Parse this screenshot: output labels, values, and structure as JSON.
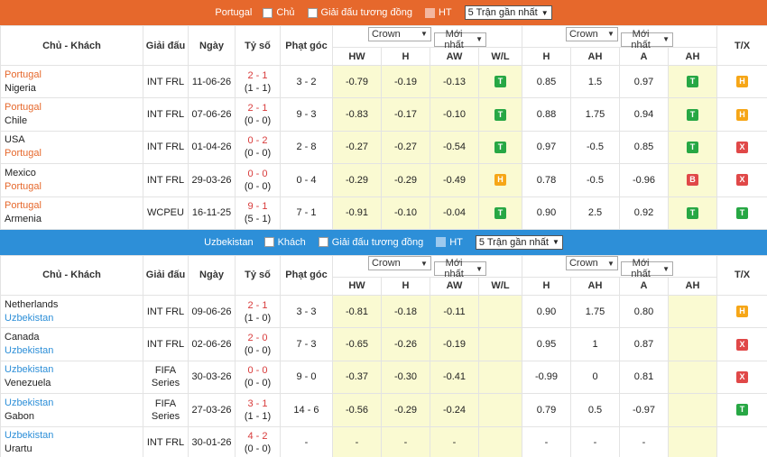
{
  "section1": {
    "team": "Portugal",
    "filter_home": "Chủ",
    "filter_same_league": "Giải đấu tương đồng",
    "filter_ht": "HT",
    "select_recent": "5 Trận gần nhất",
    "headers": {
      "teams": "Chủ - Khách",
      "league": "Giải đấu",
      "date": "Ngày",
      "score": "Tỷ số",
      "corners": "Phạt góc",
      "tx": "T/X",
      "odds1_book": "Crown",
      "odds1_time": "Mới nhất",
      "odds2_book": "Crown",
      "odds2_time": "Mới nhất",
      "hw": "HW",
      "h": "H",
      "aw": "AW",
      "wl": "W/L",
      "h2": "H",
      "ah": "AH",
      "a": "A",
      "ah2": "AH"
    },
    "rows": [
      {
        "home": "Portugal",
        "away": "Nigeria",
        "home_hl": true,
        "league": "INT FRL",
        "date": "11-06-26",
        "ft": "2 - 1",
        "ht": "(1 - 1)",
        "corners": "3 - 2",
        "hw": "-0.79",
        "h": "-0.19",
        "aw": "-0.13",
        "wl": "T",
        "h2": "0.85",
        "ah": "1.5",
        "a": "0.97",
        "ah_res": "T",
        "tx": "H"
      },
      {
        "home": "Portugal",
        "away": "Chile",
        "home_hl": true,
        "league": "INT FRL",
        "date": "07-06-26",
        "ft": "2 - 1",
        "ht": "(0 - 0)",
        "corners": "9 - 3",
        "hw": "-0.83",
        "h": "-0.17",
        "aw": "-0.10",
        "wl": "T",
        "h2": "0.88",
        "ah": "1.75",
        "a": "0.94",
        "ah_res": "T",
        "tx": "H"
      },
      {
        "home": "USA",
        "away": "Portugal",
        "home_hl": false,
        "league": "INT FRL",
        "date": "01-04-26",
        "ft": "0 - 2",
        "ht": "(0 - 0)",
        "corners": "2 - 8",
        "hw": "-0.27",
        "h": "-0.27",
        "aw": "-0.54",
        "wl": "T",
        "h2": "0.97",
        "ah": "-0.5",
        "a": "0.85",
        "ah_res": "T",
        "tx": "X"
      },
      {
        "home": "Mexico",
        "away": "Portugal",
        "home_hl": false,
        "league": "INT FRL",
        "date": "29-03-26",
        "ft": "0 - 0",
        "ht": "(0 - 0)",
        "corners": "0 - 4",
        "hw": "-0.29",
        "h": "-0.29",
        "aw": "-0.49",
        "wl": "H",
        "h2": "0.78",
        "ah": "-0.5",
        "a": "-0.96",
        "ah_res": "B",
        "tx": "X"
      },
      {
        "home": "Portugal",
        "away": "Armenia",
        "home_hl": true,
        "league": "WCPEU",
        "date": "16-11-25",
        "ft": "9 - 1",
        "ht": "(5 - 1)",
        "corners": "7 - 1",
        "hw": "-0.91",
        "h": "-0.10",
        "aw": "-0.04",
        "wl": "T",
        "h2": "0.90",
        "ah": "2.5",
        "a": "0.92",
        "ah_res": "T",
        "tx": "T"
      }
    ]
  },
  "section2": {
    "team": "Uzbekistan",
    "filter_away": "Khách",
    "filter_same_league": "Giải đấu tương đồng",
    "filter_ht": "HT",
    "select_recent": "5 Trận gần nhất",
    "headers": {
      "teams": "Chủ - Khách",
      "league": "Giải đấu",
      "date": "Ngày",
      "score": "Tỷ số",
      "corners": "Phạt góc",
      "tx": "T/X",
      "odds1_book": "Crown",
      "odds1_time": "Mới nhất",
      "odds2_book": "Crown",
      "odds2_time": "Mới nhất",
      "hw": "HW",
      "h": "H",
      "aw": "AW",
      "wl": "W/L",
      "h2": "H",
      "ah": "AH",
      "a": "A",
      "ah2": "AH"
    },
    "rows": [
      {
        "home": "Netherlands",
        "away": "Uzbekistan",
        "home_hl": false,
        "league": "INT FRL",
        "league2": "",
        "date": "09-06-26",
        "ft": "2 - 1",
        "ht": "(1 - 0)",
        "corners": "3 - 3",
        "hw": "-0.81",
        "h": "-0.18",
        "aw": "-0.11",
        "wl": "",
        "h2": "0.90",
        "ah": "1.75",
        "a": "0.80",
        "ah_res": "",
        "tx": "H"
      },
      {
        "home": "Canada",
        "away": "Uzbekistan",
        "home_hl": false,
        "league": "INT FRL",
        "league2": "",
        "date": "02-06-26",
        "ft": "2 - 0",
        "ht": "(0 - 0)",
        "corners": "7 - 3",
        "hw": "-0.65",
        "h": "-0.26",
        "aw": "-0.19",
        "wl": "",
        "h2": "0.95",
        "ah": "1",
        "a": "0.87",
        "ah_res": "",
        "tx": "X"
      },
      {
        "home": "Uzbekistan",
        "away": "Venezuela",
        "home_hl": true,
        "league": "FIFA",
        "league2": "Series",
        "date": "30-03-26",
        "ft": "0 - 0",
        "ht": "(0 - 0)",
        "corners": "9 - 0",
        "hw": "-0.37",
        "h": "-0.30",
        "aw": "-0.41",
        "wl": "",
        "h2": "-0.99",
        "ah": "0",
        "a": "0.81",
        "ah_res": "",
        "tx": "X"
      },
      {
        "home": "Uzbekistan",
        "away": "Gabon",
        "home_hl": true,
        "league": "FIFA",
        "league2": "Series",
        "date": "27-03-26",
        "ft": "3 - 1",
        "ht": "(1 - 1)",
        "corners": "14 - 6",
        "hw": "-0.56",
        "h": "-0.29",
        "aw": "-0.24",
        "wl": "",
        "h2": "0.79",
        "ah": "0.5",
        "a": "-0.97",
        "ah_res": "",
        "tx": "T"
      },
      {
        "home": "Uzbekistan",
        "away": "Urartu",
        "home_hl": true,
        "league": "INT FRL",
        "league2": "",
        "date": "30-01-26",
        "ft": "4 - 2",
        "ht": "(0 - 0)",
        "corners": "-",
        "hw": "-",
        "h": "-",
        "aw": "-",
        "wl": "",
        "h2": "-",
        "ah": "-",
        "a": "-",
        "ah_res": "",
        "tx": ""
      }
    ]
  }
}
